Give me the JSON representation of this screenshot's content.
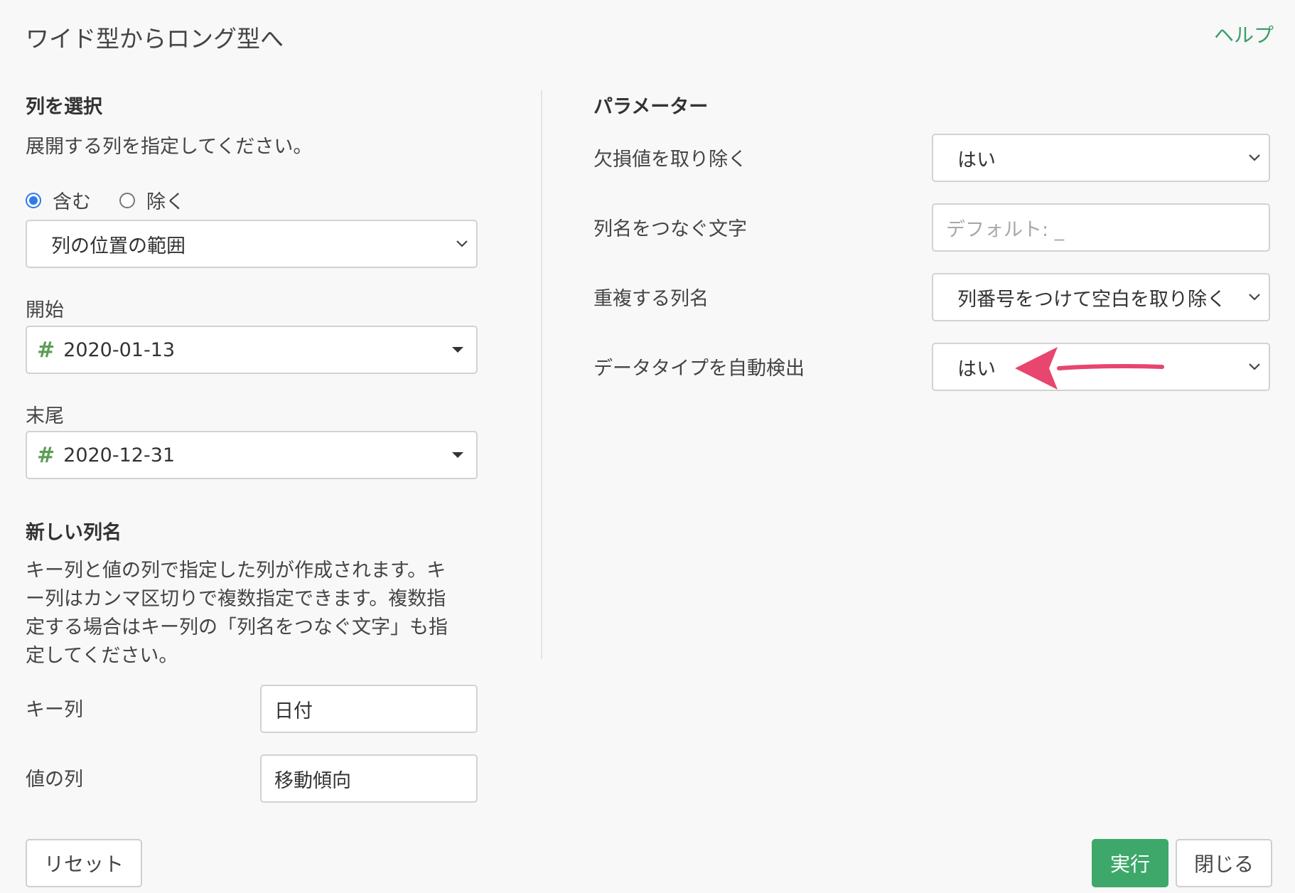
{
  "header": {
    "title": "ワイド型からロング型へ",
    "help_label": "ヘルプ"
  },
  "left": {
    "select_columns": {
      "heading": "列を選択",
      "description": "展開する列を指定してください。",
      "radio_include": "含む",
      "radio_exclude": "除く",
      "selected_radio": "含む",
      "method_value": "列の位置の範囲"
    },
    "start": {
      "label": "開始",
      "type_icon": "#",
      "value": "2020-01-13"
    },
    "end": {
      "label": "末尾",
      "type_icon": "#",
      "value": "2020-12-31"
    },
    "new_columns": {
      "heading": "新しい列名",
      "description_lines": [
        "キー列と値の列で指定した列が作成されます。キ",
        "ー列はカンマ区切りで複数指定できます。複数指",
        "定する場合はキー列の「列名をつなぐ文字」も指",
        "定してください。"
      ],
      "key_label": "キー列",
      "key_value": "日付",
      "value_label": "値の列",
      "value_value": "移動傾向"
    }
  },
  "right": {
    "heading": "パラメーター",
    "params": [
      {
        "label": "欠損値を取り除く",
        "value": "はい"
      },
      {
        "label": "列名をつなぐ文字",
        "placeholder": "デフォルト: _"
      },
      {
        "label": "重複する列名",
        "value": "列番号をつけて空白を取り除く"
      },
      {
        "label": "データタイプを自動検出",
        "value": "はい"
      }
    ]
  },
  "footer": {
    "reset_label": "リセット",
    "run_label": "実行",
    "close_label": "閉じる"
  },
  "colors": {
    "accent_green": "#3da86a",
    "help_green": "#3c9e6a",
    "radio_blue": "#2f79e8",
    "annotation_arrow": "#e8456f"
  },
  "icons": {
    "chevron": "chevron-down-icon",
    "caret": "caret-down-icon",
    "number_type": "hash-icon",
    "annotation": "annotation-arrow-icon"
  }
}
